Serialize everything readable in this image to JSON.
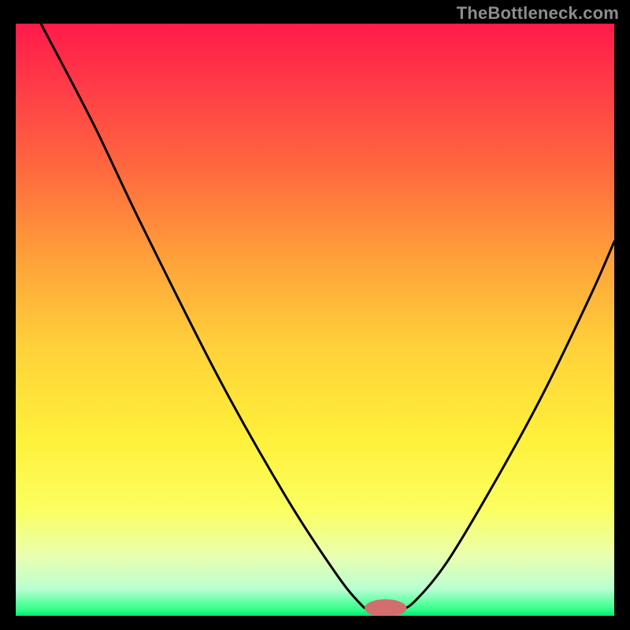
{
  "watermark": "TheBottleneck.com",
  "colors": {
    "gradient_stops": [
      {
        "offset": 0.0,
        "color": "#ff1a4a"
      },
      {
        "offset": 0.1,
        "color": "#ff3a48"
      },
      {
        "offset": 0.25,
        "color": "#ff6a3e"
      },
      {
        "offset": 0.4,
        "color": "#ffa23a"
      },
      {
        "offset": 0.55,
        "color": "#ffd23a"
      },
      {
        "offset": 0.7,
        "color": "#fff03a"
      },
      {
        "offset": 0.82,
        "color": "#fbff60"
      },
      {
        "offset": 0.9,
        "color": "#e9ffb0"
      },
      {
        "offset": 0.955,
        "color": "#b8ffd2"
      },
      {
        "offset": 0.99,
        "color": "#2fff87"
      },
      {
        "offset": 1.0,
        "color": "#00e86f"
      }
    ],
    "marker": "#d36e6e",
    "curve": "#000000",
    "background": "#000000"
  },
  "chart_data": {
    "type": "line",
    "title": "",
    "xlabel": "",
    "ylabel": "",
    "xlim": [
      0,
      1
    ],
    "ylim": [
      0,
      1
    ],
    "grid": false,
    "series": [
      {
        "name": "bottleneck-curve",
        "points": [
          {
            "x": 0.042,
            "y": 1.0
          },
          {
            "x": 0.13,
            "y": 0.83
          },
          {
            "x": 0.208,
            "y": 0.665
          },
          {
            "x": 0.34,
            "y": 0.4
          },
          {
            "x": 0.452,
            "y": 0.2
          },
          {
            "x": 0.536,
            "y": 0.07
          },
          {
            "x": 0.576,
            "y": 0.02
          },
          {
            "x": 0.59,
            "y": 0.012
          },
          {
            "x": 0.62,
            "y": 0.012
          },
          {
            "x": 0.64,
            "y": 0.012
          },
          {
            "x": 0.664,
            "y": 0.022
          },
          {
            "x": 0.72,
            "y": 0.09
          },
          {
            "x": 0.8,
            "y": 0.225
          },
          {
            "x": 0.88,
            "y": 0.373
          },
          {
            "x": 0.96,
            "y": 0.54
          },
          {
            "x": 1.0,
            "y": 0.632
          }
        ]
      }
    ],
    "marker": {
      "x": 0.618,
      "y": 0.013,
      "rx": 0.035,
      "ry": 0.015
    }
  }
}
